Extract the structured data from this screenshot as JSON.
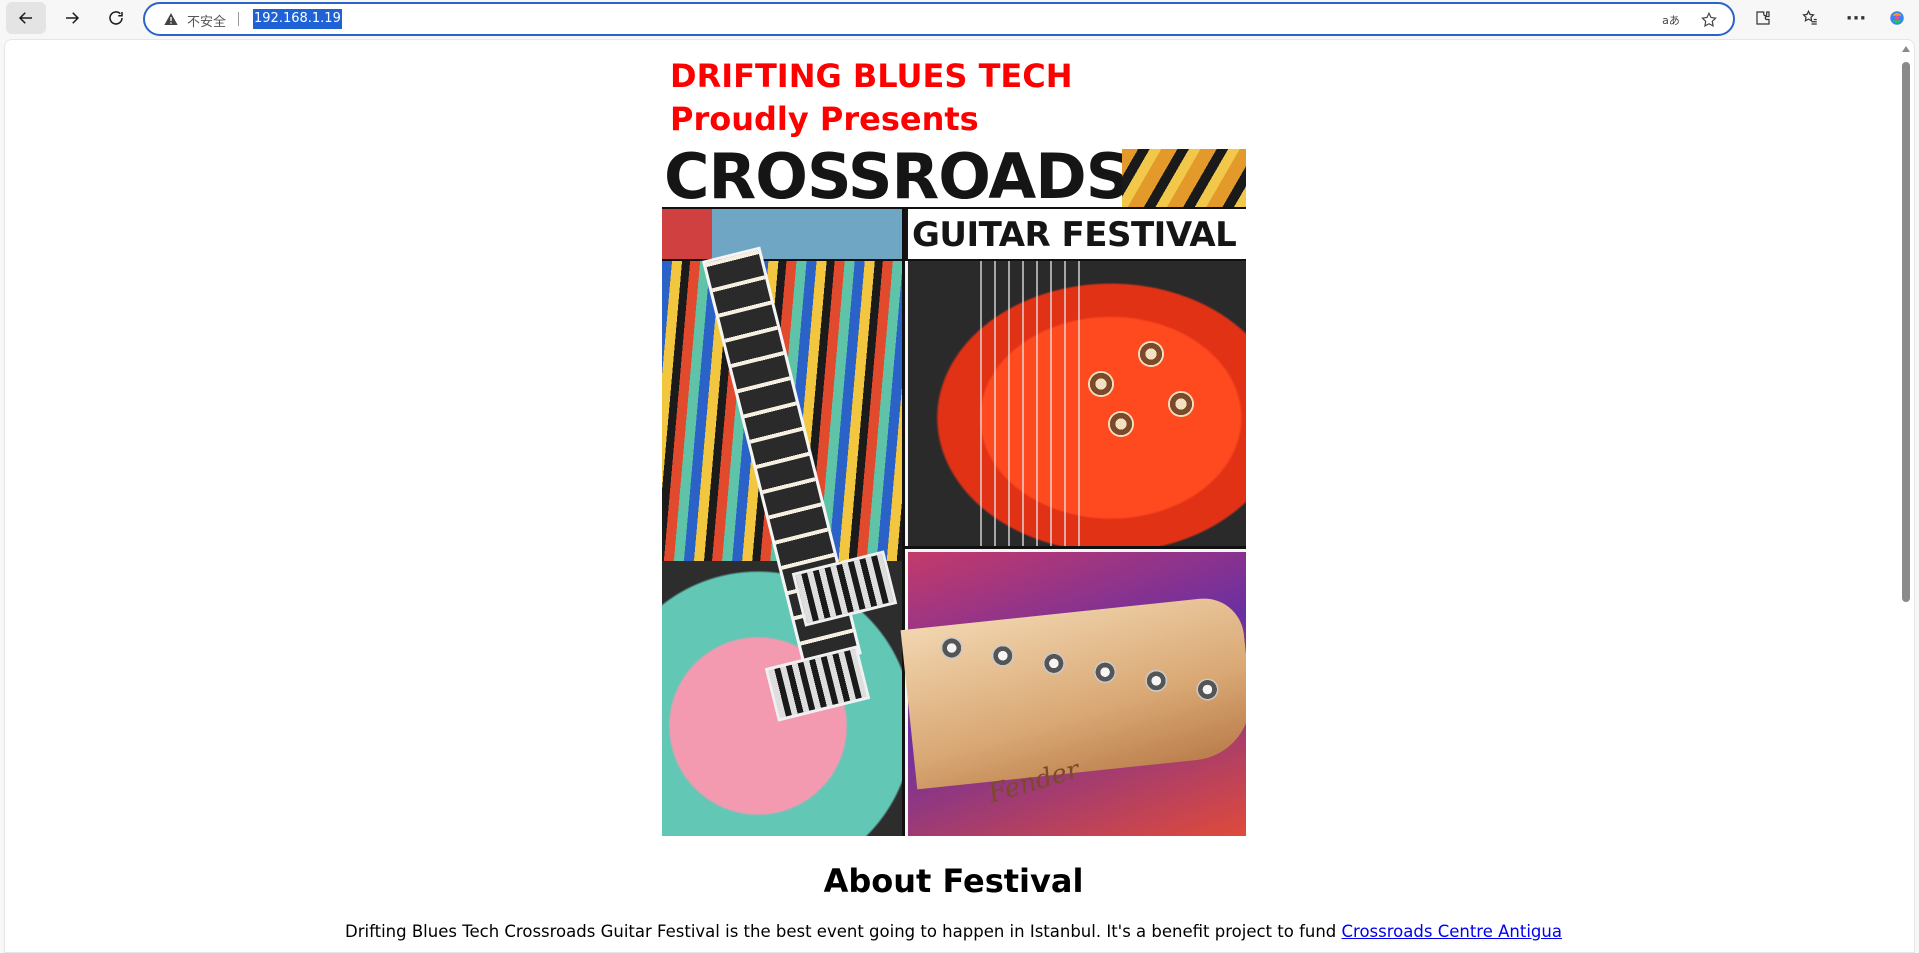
{
  "browser": {
    "security_label": "不安全",
    "url": "192.168.1.19",
    "translate_glyph": "aあ",
    "more_glyph": "···"
  },
  "page": {
    "promo": {
      "line1": "DRIFTING BLUES TECH",
      "line2": "Proudly Presents"
    },
    "poster": {
      "title": "CROSSROADS",
      "subtitle": "GUITAR FESTIVAL",
      "brand_script": "Fender",
      "colors": {
        "title_text": "#151515",
        "promo_red": "#ff0000"
      }
    },
    "about": {
      "heading": "About Festival",
      "text": "Drifting Blues Tech Crossroads Guitar Festival is the best event going to happen in Istanbul. It's a benefit project to fund ",
      "link_text": "Crossroads Centre Antigua"
    }
  },
  "icons": [
    "back-arrow-icon",
    "forward-arrow-icon",
    "reload-icon",
    "warning-icon",
    "translate-icon",
    "star-icon",
    "extensions-icon",
    "favorites-icon",
    "more-icon",
    "copilot-icon"
  ]
}
